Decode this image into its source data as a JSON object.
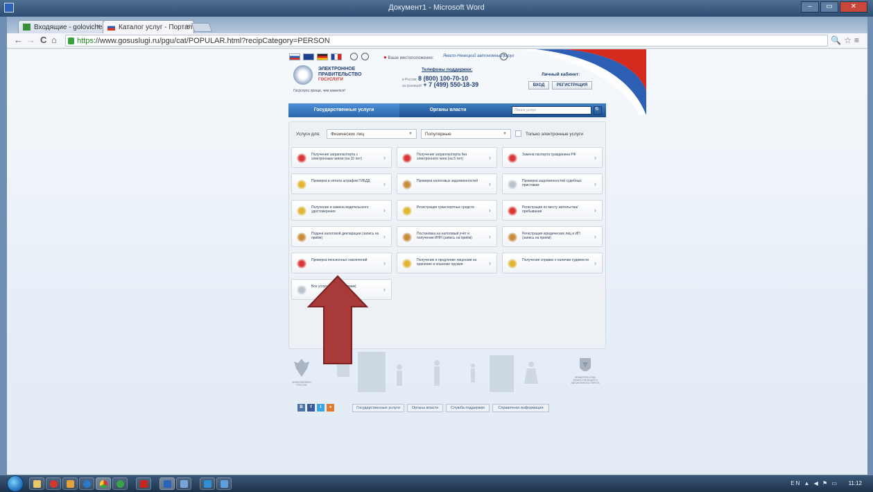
{
  "word": {
    "title": "Документ1 - Microsoft Word"
  },
  "browser": {
    "tabs": [
      {
        "label": "Входящие - golovicherg",
        "close": "×"
      },
      {
        "label": "Каталог услуг - Портал г",
        "close": "×"
      }
    ],
    "url_scheme": "https",
    "url_rest": "://www.gosuslugi.ru/pgu/cat/POPULAR.html?recipCategory=PERSON",
    "nav": {
      "back": "←",
      "forward": "→",
      "reload": "C",
      "home": "⌂"
    },
    "toolbar_right": "🔍☆≡"
  },
  "site": {
    "location_label": "Ваше местоположение:",
    "location_value": "Ямало-Ненецкий автономный округ",
    "location_help": "?",
    "logo": {
      "line1": "ЭЛЕКТРОННОЕ",
      "line2": "ПРАВИТЕЛЬСТВО",
      "line3": "ГОСУСЛУГИ"
    },
    "slogan": "Госуслуги проще, чем кажется!",
    "support": {
      "title": "Телефоны поддержки:",
      "russia_label": "в России",
      "russia_phone": "8 (800) 100-70-10",
      "abroad_label": "за границей",
      "abroad_phone": "+ 7 (499) 550-18-39"
    },
    "cabinet": {
      "title": "Личный кабинет:",
      "login": "ВХОД",
      "register": "РЕГИСТРАЦИЯ"
    },
    "nav": {
      "services": "Государственные услуги",
      "authorities": "Органы власти",
      "search_placeholder": "Поиск услуг",
      "search_btn": "🔍"
    },
    "filters": {
      "label": "Услуги для:",
      "recipient": "Физических лиц",
      "sort": "Популярные",
      "electronic_only": "Только электронные услуги",
      "caret": "▼"
    },
    "cards": [
      "Получение загранпаспорта с электронным чипом (на 10 лет)",
      "Получение загранпаспорта без электронного чипа (на 5 лет)",
      "Замена паспорта гражданина РФ",
      "Проверка и оплата штрафов ГИБДД",
      "Проверка налоговых задолженностей",
      "Проверка задолженностей судебных приставам",
      "Получение и замена водительского удостоверения",
      "Регистрация транспортных средств",
      "Регистрация по месту жительства/пребывания",
      "Подача налоговой декларации (запись на приём)",
      "Постановка на налоговый учёт и получение ИНН (запись на приём)",
      "Регистрация юридических лиц и ИП (запись на приём)",
      "Проверка пенсионных накоплений",
      "Получение и продление лицензии на хранение и ношение оружия",
      "Получение справки о наличии судимости",
      "Все услуги (по ведомствам)"
    ],
    "card_arrow": "›",
    "footer": {
      "links": [
        "Государственные услуги",
        "Органы власти",
        "Служба поддержки",
        "Справочная информация"
      ],
      "social": [
        "В",
        "f",
        "t",
        "●"
      ],
      "gov_left": "МИНКОМСВЯЗЬ РОССИИ",
      "gov_right": "ПРАВИТЕЛЬСТВО ЯМАЛО-НЕНЕЦКОГО АВТОНОМНОГО ОКРУГА"
    }
  },
  "taskbar": {
    "tray": "EN ▲ ◀ ⚑ ▭",
    "time": "11:12"
  },
  "colors": {
    "accent": "#1d4f90",
    "annotation_arrow": "#a93a3a",
    "brand_red": "#d0312d"
  }
}
